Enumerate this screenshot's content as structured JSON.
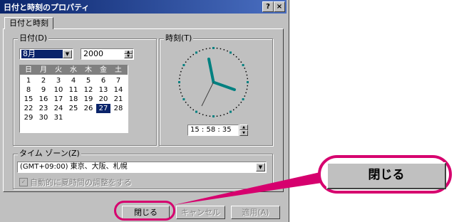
{
  "window": {
    "title": "日付と時刻のプロパティ",
    "help_label": "?",
    "close_label": "×"
  },
  "tabs": [
    {
      "label": "日付と時刻"
    }
  ],
  "date_group": {
    "label": "日付(D)",
    "month_value": "8月",
    "year_value": "2000",
    "weekday_headers": [
      "日",
      "月",
      "火",
      "水",
      "木",
      "金",
      "土"
    ],
    "days": [
      [
        "",
        "",
        "1",
        "2",
        "3",
        "4",
        "5"
      ],
      [
        "6",
        "7",
        "8",
        "9",
        "10",
        "11",
        "12"
      ],
      [
        "13",
        "14",
        "15",
        "16",
        "17",
        "18",
        "19"
      ],
      [
        "20",
        "21",
        "22",
        "23",
        "24",
        "25",
        "26"
      ],
      [
        "27",
        "28",
        "29",
        "30",
        "31",
        "",
        ""
      ]
    ],
    "days_display": [
      [
        "1",
        "2",
        "3",
        "4",
        "5",
        "6",
        "7"
      ],
      [
        "8",
        "9",
        "10",
        "11",
        "12",
        "13",
        "14"
      ],
      [
        "15",
        "16",
        "17",
        "18",
        "19",
        "20",
        "21"
      ],
      [
        "22",
        "23",
        "24",
        "25",
        "26",
        "27",
        "28"
      ],
      [
        "29",
        "30",
        "31",
        "",
        "",
        "",
        ""
      ]
    ],
    "selected_day": "27"
  },
  "time_group": {
    "label": "時刻(T)",
    "time_value": "15 : 58 : 35"
  },
  "timezone_group": {
    "label": "タイム ゾーン(Z)",
    "value": "(GMT+09:00) 東京、大阪、札幌",
    "dst_label": "自動的に夏時間の調整をする"
  },
  "buttons": {
    "close": "閉じる",
    "cancel": "キャンセル",
    "apply": "適用(A)"
  },
  "callout": {
    "label": "閉じる",
    "highlight_color": "#d6006e"
  }
}
